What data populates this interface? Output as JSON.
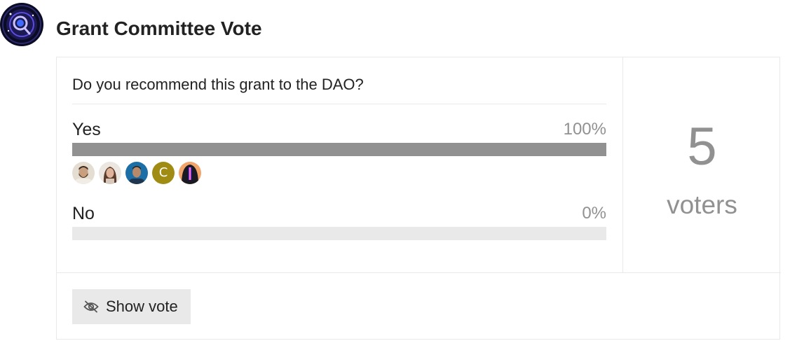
{
  "header": {
    "title": "Grant Committee Vote",
    "logo_icon": "magnifier-orbit-logo"
  },
  "poll": {
    "question": "Do you recommend this grant to the DAO?",
    "options": [
      {
        "label": "Yes",
        "percent_text": "100%",
        "fraction": 1.0,
        "voters": [
          {
            "type": "photo",
            "icon": "bearded-man-avatar"
          },
          {
            "type": "photo",
            "icon": "woman-long-hair-avatar"
          },
          {
            "type": "photo",
            "icon": "man-blue-background-avatar"
          },
          {
            "type": "letter",
            "letter": "C",
            "color": "#a08c13"
          },
          {
            "type": "photo",
            "icon": "hooded-figure-avatar"
          }
        ]
      },
      {
        "label": "No",
        "percent_text": "0%",
        "fraction": 0.0,
        "voters": []
      }
    ],
    "voter_count": "5",
    "voter_count_label": "voters",
    "show_vote_label": "Show vote",
    "show_vote_icon": "eye-slash-icon"
  },
  "colors": {
    "bar_fill": "#919191",
    "bar_track": "#e9e9e9",
    "muted_text": "#919191",
    "border": "#e9e9e9"
  }
}
